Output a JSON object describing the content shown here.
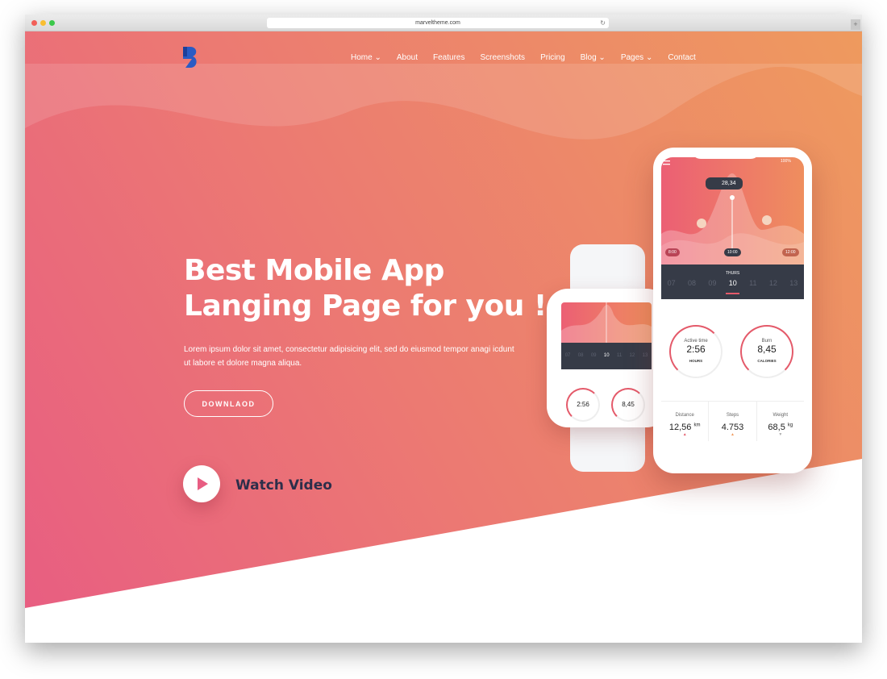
{
  "browser": {
    "url": "marveltheme.com"
  },
  "nav": {
    "items": [
      "Home",
      "About",
      "Features",
      "Screenshots",
      "Pricing",
      "Blog",
      "Pages",
      "Contact"
    ],
    "dropdown": [
      true,
      false,
      false,
      false,
      false,
      true,
      true,
      false
    ]
  },
  "hero": {
    "title_line1": "Best Mobile App",
    "title_line2": "Langing Page for you !",
    "lead": "Lorem ipsum dolor sit amet, consectetur adipisicing elit, sed do eiusmod tempor anagi icdunt ut labore et dolore magna aliqua.",
    "download": "DOWNLAOD",
    "watch_video": "Watch Video"
  },
  "phone": {
    "battery": "100%",
    "bubble": "28,34",
    "times": [
      "8:00",
      "10:00",
      "12:00"
    ],
    "day_name": "THURS",
    "days": [
      "07",
      "08",
      "09",
      "10",
      "11",
      "12",
      "13"
    ],
    "active": {
      "label": "Active time",
      "value": "2:56",
      "unit": "HOURS"
    },
    "burn": {
      "label": "Burn",
      "value": "8,45",
      "unit": "CALORIES"
    },
    "stats": [
      {
        "label": "Distance",
        "value": "12,56",
        "unit": "km"
      },
      {
        "label": "Steps",
        "value": "4.753",
        "unit": ""
      },
      {
        "label": "Weight",
        "value": "68,5",
        "unit": "kg"
      }
    ]
  },
  "colors": {
    "gradient_start": "#e85d82",
    "gradient_end": "#ee9a5e",
    "dark": "#2d2e4a"
  }
}
